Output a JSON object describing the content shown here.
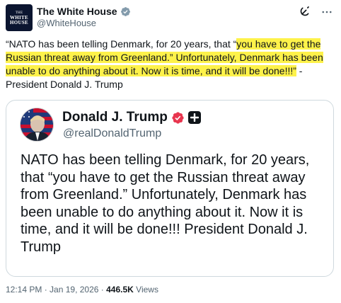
{
  "author": {
    "avatar_text": [
      "THE",
      "WHITE",
      "HOUSE"
    ],
    "display_name": "The White House",
    "handle": "@WhiteHouse"
  },
  "post": {
    "text_before_highlight": "“NATO has been telling Denmark, for 20 years, that “",
    "text_highlighted": "you have to get the Russian threat away from Greenland.” Unfortunately, Denmark has been unable to do anything about it. Now it is time, and it will be done!!!”",
    "text_after_highlight": " - President Donald J. Trump"
  },
  "quoted": {
    "display_name": "Donald J. Trump",
    "handle": "@realDonaldTrump",
    "text": "NATO has been telling Denmark, for 20 years, that “you have to get the Russian threat away from Greenland.” Unfortunately, Denmark has been unable to do anything about it. Now it is time, and it will be done!!! President Donald J. Trump"
  },
  "meta": {
    "time": "12:14 PM",
    "separator": " · ",
    "date": "Jan 19, 2026",
    "views_count": "446.5K",
    "views_label": " Views"
  },
  "icons": {
    "verified_gray": "verified-gray-icon",
    "verified_red": "verified-red-icon",
    "plus": "plus-icon",
    "grok": "grok-icon",
    "more": "more-icon"
  },
  "colors": {
    "highlight": "#fef24a",
    "verified_gray": "#829aab",
    "verified_red": "#e8364f",
    "secondary_text": "#536471"
  }
}
